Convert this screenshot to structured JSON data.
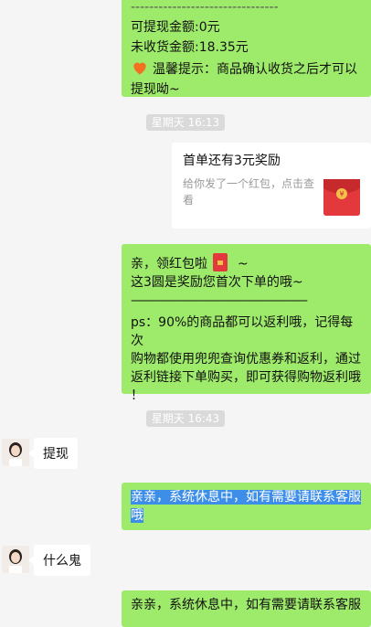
{
  "messages": {
    "m1": {
      "dashes": "--------------------------------",
      "line1": "可提现金额:0元",
      "line2": "未收货金额:18.35元",
      "line3": "温馨提示：商品确认收货之后才可以",
      "line4": "提现呦~"
    },
    "ts1": "星期天 16:13",
    "card": {
      "title": "首单还有3元奖励",
      "desc": "给你发了一个红包，点击查看"
    },
    "m2": {
      "line1a": "亲，领红包啦",
      "line1b": "~",
      "line2": "这3圆是奖励您首次下单的哦~",
      "line3": "————————————————",
      "line4": "ps：90%的商品都可以返利哦，记得每次",
      "line5": "购物都使用兜兜查询优惠券和返利，通过",
      "line6": "返利链接下单购买，即可获得购物返利哦",
      "line7": "！"
    },
    "ts2": "星期天 16:43",
    "u1": "提现",
    "m3": {
      "line1": "亲亲，系统休息中，如有需要请联系客服",
      "line2": "哦"
    },
    "u2": "什么鬼",
    "m4": {
      "line1": "亲亲，系统休息中，如有需要请联系客服"
    }
  }
}
